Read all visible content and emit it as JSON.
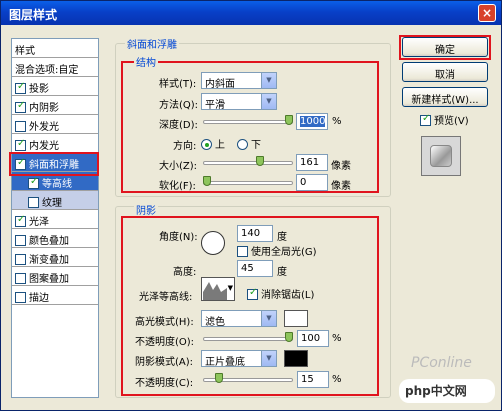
{
  "window": {
    "title": "图层样式",
    "close_glyph": "×"
  },
  "left_panel": {
    "items": [
      {
        "label": "样式",
        "checkbox": false,
        "checked": false,
        "state": "header"
      },
      {
        "label": "混合选项:自定",
        "checkbox": false,
        "checked": false,
        "state": "normal"
      },
      {
        "label": "投影",
        "checkbox": true,
        "checked": true,
        "state": "normal"
      },
      {
        "label": "内阴影",
        "checkbox": true,
        "checked": true,
        "state": "normal"
      },
      {
        "label": "外发光",
        "checkbox": true,
        "checked": false,
        "state": "normal"
      },
      {
        "label": "内发光",
        "checkbox": true,
        "checked": true,
        "state": "normal"
      },
      {
        "label": "斜面和浮雕",
        "checkbox": true,
        "checked": true,
        "state": "selected"
      },
      {
        "label": "等高线",
        "checkbox": true,
        "checked": true,
        "state": "sub-dark"
      },
      {
        "label": "纹理",
        "checkbox": true,
        "checked": false,
        "state": "sub"
      },
      {
        "label": "光泽",
        "checkbox": true,
        "checked": true,
        "state": "normal"
      },
      {
        "label": "颜色叠加",
        "checkbox": true,
        "checked": false,
        "state": "normal"
      },
      {
        "label": "渐变叠加",
        "checkbox": true,
        "checked": false,
        "state": "normal"
      },
      {
        "label": "图案叠加",
        "checkbox": true,
        "checked": false,
        "state": "normal"
      },
      {
        "label": "描边",
        "checkbox": true,
        "checked": false,
        "state": "normal"
      }
    ]
  },
  "bevel": {
    "group_title": "斜面和浮雕",
    "structure_title": "结构",
    "style_label": "样式(T):",
    "style_value": "内斜面",
    "technique_label": "方法(Q):",
    "technique_value": "平滑",
    "depth_label": "深度(D):",
    "depth_value": "1000",
    "depth_unit": "%",
    "depth_slider": 1.0,
    "direction_label": "方向:",
    "direction_up": "上",
    "direction_down": "下",
    "size_label": "大小(Z):",
    "size_value": "161",
    "size_unit": "像素",
    "size_slider": 0.65,
    "soften_label": "软化(F):",
    "soften_value": "0",
    "soften_unit": "像素",
    "soften_slider": 0.0
  },
  "shading": {
    "title": "阴影",
    "angle_label": "角度(N):",
    "angle_value": "140",
    "angle_unit": "度",
    "global_light_label": "使用全局光(G)",
    "altitude_label": "高度:",
    "altitude_value": "45",
    "altitude_unit": "度",
    "gloss_contour_label": "光泽等高线:",
    "antialias_label": "消除锯齿(L)",
    "highlight_mode_label": "高光模式(H):",
    "highlight_mode_value": "滤色",
    "highlight_color": "#ffffff",
    "highlight_opacity_label": "不透明度(O):",
    "highlight_opacity_value": "100",
    "highlight_opacity_unit": "%",
    "highlight_opacity_slider": 1.0,
    "shadow_mode_label": "阴影模式(A):",
    "shadow_mode_value": "正片叠底",
    "shadow_color": "#000000",
    "shadow_opacity_label": "不透明度(C):",
    "shadow_opacity_value": "15",
    "shadow_opacity_unit": "%",
    "shadow_opacity_slider": 0.15
  },
  "buttons": {
    "ok": "确定",
    "cancel": "取消",
    "new_style": "新建样式(W)...",
    "preview": "预览(V)"
  },
  "watermarks": {
    "pconline": "PConline",
    "php": "php中文网"
  },
  "colors": {
    "accent_red": "#e0141e",
    "title_blue": "#0046d5",
    "select_blue": "#316ac5"
  }
}
